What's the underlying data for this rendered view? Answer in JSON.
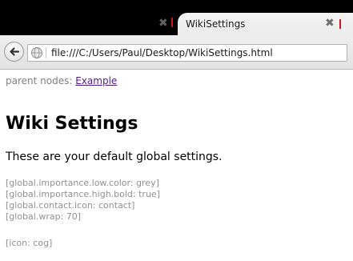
{
  "browser": {
    "inactive_tab": {
      "close_glyph": "✖"
    },
    "active_tab": {
      "title": "WikiSettings",
      "close_glyph": "✖"
    },
    "url": "file:///C:/Users/Paul/Desktop/WikiSettings.html",
    "accent_color": "#d01818",
    "icons": {
      "back": "back-arrow-icon",
      "site": "globe-icon"
    }
  },
  "page": {
    "parent_label": "parent nodes:",
    "parent_link": "Example",
    "title": "Wiki Settings",
    "intro": "These are your default global settings.",
    "settings": [
      "[global.importance.low.color: grey]",
      "[global.importance.high.bold: true]",
      "[global.contact.icon: contact]",
      "[global.wrap: 70]"
    ],
    "icon_setting": "[icon: cog]"
  }
}
